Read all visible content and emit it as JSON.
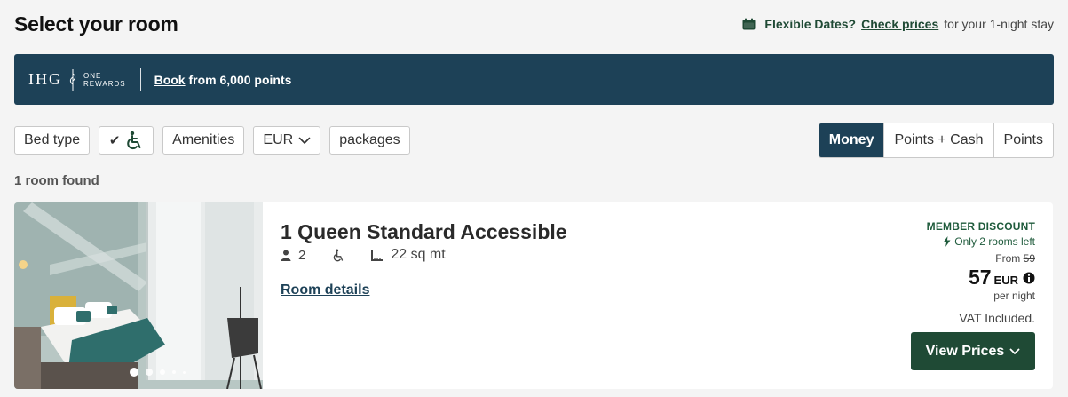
{
  "header": {
    "title": "Select your room",
    "flex_label": "Flexible Dates?",
    "flex_link": "Check prices",
    "flex_rest": "for your 1-night stay"
  },
  "banner": {
    "logo_text": "IHG",
    "logo_sub_1": "ONE",
    "logo_sub_2": "REWARDS",
    "link": "Book",
    "text": "from 6,000 points"
  },
  "filters": {
    "bed_type": "Bed type",
    "accessibility_check": "✔",
    "amenities": "Amenities",
    "currency": "EUR",
    "packages": "packages"
  },
  "payment_toggle": {
    "options": [
      "Money",
      "Points + Cash",
      "Points"
    ],
    "selected": "Money"
  },
  "rooms_found": "1 room found",
  "room": {
    "name": "1 Queen Standard Accessible",
    "guests": "2",
    "size": "22 sq mt",
    "details_link": "Room details",
    "member_discount": "MEMBER DISCOUNT",
    "rooms_left": "Only 2 rooms left",
    "from_label": "From",
    "old_price": "59",
    "price": "57",
    "currency": "EUR",
    "per_night": "per night",
    "vat": "VAT Included.",
    "cta": "View Prices",
    "photo_slides": 5,
    "active_slide": 1
  },
  "colors": {
    "brand_navy": "#1d4157",
    "brand_green": "#1f4a35"
  }
}
